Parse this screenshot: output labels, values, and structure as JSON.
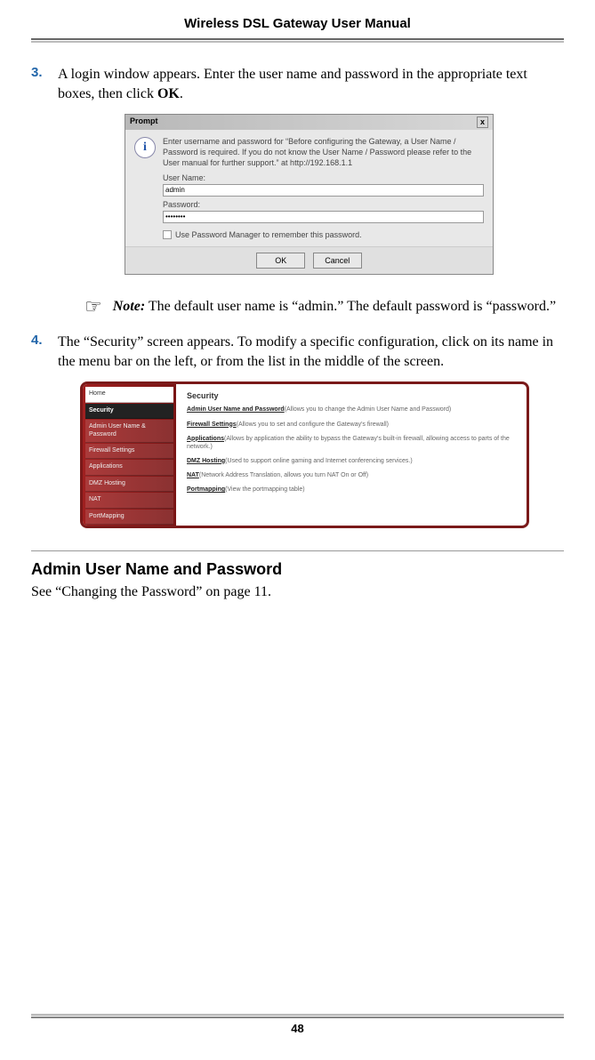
{
  "header": {
    "title": "Wireless DSL Gateway User Manual"
  },
  "steps": {
    "s3": {
      "num": "3.",
      "text_a": " A login window appears. Enter the user name and password in the appropriate text boxes, then click ",
      "text_b": "OK",
      "text_c": "."
    },
    "s4": {
      "num": "4.",
      "text": "The “Security” screen appears. To modify a specific configuration, click on its name in the menu bar on the left, or from the list in the middle of the screen."
    }
  },
  "prompt": {
    "title": "Prompt",
    "close": "x",
    "icon": "i",
    "msg": "Enter username and password for “Before configuring the Gateway, a User Name / Password is required. If you do not know the User Name / Password please refer to the User manual for further support.” at http://192.168.1.1",
    "label_user": "User Name:",
    "val_user": "admin",
    "label_pw": "Password:",
    "val_pw": "••••••••",
    "check_label": "Use Password Manager to remember this password.",
    "ok": "OK",
    "cancel": "Cancel"
  },
  "note": {
    "icon": "☞",
    "label": "Note:",
    "text": " The default user name is “admin.” The default password is “password.”"
  },
  "security": {
    "sidebar": {
      "home": "Home",
      "active": "Security",
      "items": [
        "Admin User Name & Password",
        "Firewall Settings",
        "Applications",
        "DMZ Hosting",
        "NAT",
        "PortMapping"
      ]
    },
    "main": {
      "title": "Security",
      "rows": [
        {
          "link": "Admin User Name and Password",
          "desc": "(Allows you to change the Admin User Name and Password)"
        },
        {
          "link": "Firewall Settings",
          "desc": "(Allows you to set and configure the Gateway's firewall)"
        },
        {
          "link": "Applications",
          "desc": "(Allows by application the ability to bypass the Gateway's built-in firewall, allowing access to parts of the network.)"
        },
        {
          "link": "DMZ Hosting",
          "desc": "(Used to support online gaming and Internet conferencing services.)"
        },
        {
          "link": "NAT",
          "desc": "(Network Address Translation, allows you turn NAT On or Off)"
        },
        {
          "link": "Portmapping",
          "desc": "(View the portmapping table)"
        }
      ]
    }
  },
  "section": {
    "heading": "Admin User Name and Password",
    "text": "See “Changing the Password” on page 11."
  },
  "footer": {
    "page": "48"
  }
}
